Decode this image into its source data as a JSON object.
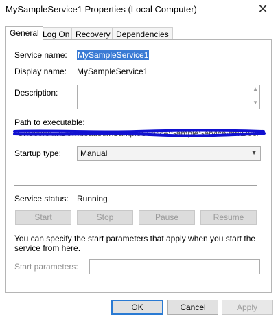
{
  "window": {
    "title": "MySampleService1 Properties (Local Computer)",
    "close": "✕"
  },
  "tabs": [
    "General",
    "Log On",
    "Recovery",
    "Dependencies"
  ],
  "general": {
    "service_name_label": "Service name:",
    "service_name_value": "MySampleService1",
    "display_name_label": "Display name:",
    "display_name_value": "MySampleService1",
    "description_label": "Description:",
    "path_label": "Path to executable:",
    "path_value": "\"C:\\Users\\...\\Downloads\\...\\SampleService\\SampleService\\bin\\Debug\\SampleServi",
    "startup_type_label": "Startup type:",
    "startup_type_value": "Manual",
    "service_status_label": "Service status:",
    "service_status_value": "Running",
    "buttons": {
      "start": "Start",
      "stop": "Stop",
      "pause": "Pause",
      "resume": "Resume"
    },
    "help_text": "You can specify the start parameters that apply when you start the service from here.",
    "start_params_label": "Start parameters:"
  },
  "footer": {
    "ok": "OK",
    "cancel": "Cancel",
    "apply": "Apply"
  },
  "colors": {
    "selection": "#3a7bd5",
    "redaction": "#1010d0",
    "default_button_border": "#2a7ad3"
  }
}
